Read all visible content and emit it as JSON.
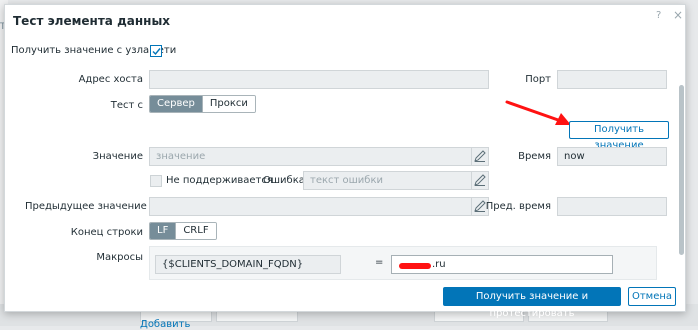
{
  "dialog": {
    "title": "Тест элемента данных",
    "help_glyph": "?",
    "close_glyph": "×"
  },
  "form": {
    "get_from_host_label": "Получить значение с узла сети",
    "get_from_host_checked": true,
    "host_address_label": "Адрес хоста",
    "host_address_value": "",
    "port_label": "Порт",
    "port_value": "",
    "test_with_label": "Тест с",
    "test_with_options": [
      "Сервер",
      "Прокси"
    ],
    "test_with_selected": "Сервер",
    "get_value_button": "Получить значение",
    "value_label": "Значение",
    "value_placeholder": "значение",
    "time_label": "Время",
    "time_value": "now",
    "not_supported_label": "Не поддерживается",
    "not_supported_checked": false,
    "error_label": "Ошибка",
    "error_placeholder": "текст ошибки",
    "prev_value_label": "Предыдущее значение",
    "prev_value_value": "",
    "prev_time_label": "Пред. время",
    "prev_time_value": "",
    "eol_label": "Конец строки",
    "eol_options": [
      "LF",
      "CRLF"
    ],
    "eol_selected": "LF",
    "macros_label": "Макросы",
    "macro_name": "{$CLIENTS_DOMAIN_FQDN}",
    "macro_equals": "=",
    "macro_value_visible_suffix": ".ru"
  },
  "footer": {
    "get_and_test_button": "Получить значение и протестировать",
    "cancel_button": "Отмена"
  },
  "background": {
    "tab_fragment": "Т",
    "link_fragment": "Добавить"
  },
  "colors": {
    "accent": "#0275b8",
    "segment_active": "#768d99",
    "annotation_arrow": "#ff1212"
  }
}
